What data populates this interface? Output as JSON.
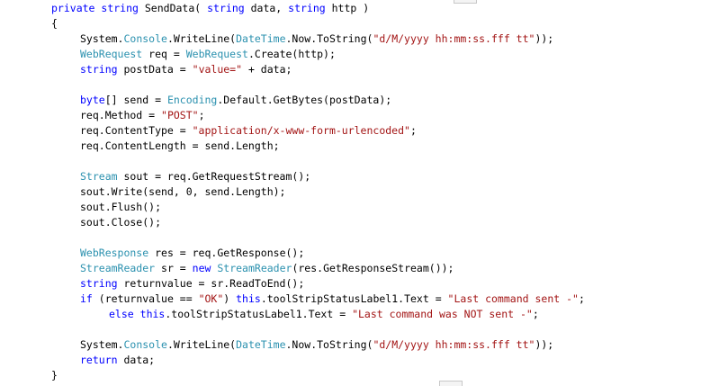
{
  "editor": {
    "colors": {
      "keyword": "#0000ff",
      "type": "#2b91af",
      "string": "#a31515",
      "plain": "#000000",
      "background": "#ffffff"
    },
    "lines": [
      {
        "tokens": [
          [
            "kw",
            "private"
          ],
          [
            "pl",
            " "
          ],
          [
            "kw",
            "string"
          ],
          [
            "pl",
            " SendData( "
          ],
          [
            "kw",
            "string"
          ],
          [
            "pl",
            " data, "
          ],
          [
            "kw",
            "string"
          ],
          [
            "pl",
            " http )"
          ]
        ]
      },
      {
        "tokens": [
          [
            "pl",
            "{"
          ]
        ]
      },
      {
        "tokens": [
          [
            "pl",
            "System."
          ],
          [
            "ty",
            "Console"
          ],
          [
            "pl",
            ".WriteLine("
          ],
          [
            "ty",
            "DateTime"
          ],
          [
            "pl",
            ".Now.ToString("
          ],
          [
            "st",
            "\"d/M/yyyy hh:mm:ss.fff tt\""
          ],
          [
            "pl",
            "));"
          ]
        ]
      },
      {
        "tokens": [
          [
            "ty",
            "WebRequest"
          ],
          [
            "pl",
            " req = "
          ],
          [
            "ty",
            "WebRequest"
          ],
          [
            "pl",
            ".Create(http);"
          ]
        ]
      },
      {
        "tokens": [
          [
            "kw",
            "string"
          ],
          [
            "pl",
            " postData = "
          ],
          [
            "st",
            "\"value=\""
          ],
          [
            "pl",
            " + data;"
          ]
        ]
      },
      {
        "tokens": []
      },
      {
        "tokens": [
          [
            "kw",
            "byte"
          ],
          [
            "pl",
            "[] send = "
          ],
          [
            "ty",
            "Encoding"
          ],
          [
            "pl",
            ".Default.GetBytes(postData);"
          ]
        ]
      },
      {
        "tokens": [
          [
            "pl",
            "req.Method = "
          ],
          [
            "st",
            "\"POST\""
          ],
          [
            "pl",
            ";"
          ]
        ]
      },
      {
        "tokens": [
          [
            "pl",
            "req.ContentType = "
          ],
          [
            "st",
            "\"application/x-www-form-urlencoded\""
          ],
          [
            "pl",
            ";"
          ]
        ]
      },
      {
        "tokens": [
          [
            "pl",
            "req.ContentLength = send.Length;"
          ]
        ]
      },
      {
        "tokens": []
      },
      {
        "tokens": [
          [
            "ty",
            "Stream"
          ],
          [
            "pl",
            " sout = req.GetRequestStream();"
          ]
        ]
      },
      {
        "tokens": [
          [
            "pl",
            "sout.Write(send, 0, send.Length);"
          ]
        ]
      },
      {
        "tokens": [
          [
            "pl",
            "sout.Flush();"
          ]
        ]
      },
      {
        "tokens": [
          [
            "pl",
            "sout.Close();"
          ]
        ]
      },
      {
        "tokens": []
      },
      {
        "tokens": [
          [
            "ty",
            "WebResponse"
          ],
          [
            "pl",
            " res = req.GetResponse();"
          ]
        ]
      },
      {
        "tokens": [
          [
            "ty",
            "StreamReader"
          ],
          [
            "pl",
            " sr = "
          ],
          [
            "kw",
            "new"
          ],
          [
            "pl",
            " "
          ],
          [
            "ty",
            "StreamReader"
          ],
          [
            "pl",
            "(res.GetResponseStream());"
          ]
        ]
      },
      {
        "tokens": [
          [
            "kw",
            "string"
          ],
          [
            "pl",
            " returnvalue = sr.ReadToEnd();"
          ]
        ]
      },
      {
        "tokens": [
          [
            "kw",
            "if"
          ],
          [
            "pl",
            " (returnvalue == "
          ],
          [
            "st",
            "\"OK\""
          ],
          [
            "pl",
            ") "
          ],
          [
            "kw",
            "this"
          ],
          [
            "pl",
            ".toolStripStatusLabel1.Text = "
          ],
          [
            "st",
            "\"Last command sent -\""
          ],
          [
            "pl",
            ";"
          ]
        ]
      },
      {
        "tokens": [
          [
            "kw",
            "else"
          ],
          [
            "pl",
            " "
          ],
          [
            "kw",
            "this"
          ],
          [
            "pl",
            ".toolStripStatusLabel1.Text = "
          ],
          [
            "st",
            "\"Last command was NOT sent -\""
          ],
          [
            "pl",
            ";"
          ]
        ]
      },
      {
        "tokens": []
      },
      {
        "tokens": [
          [
            "pl",
            "System."
          ],
          [
            "ty",
            "Console"
          ],
          [
            "pl",
            ".WriteLine("
          ],
          [
            "ty",
            "DateTime"
          ],
          [
            "pl",
            ".Now.ToString("
          ],
          [
            "st",
            "\"d/M/yyyy hh:mm:ss.fff tt\""
          ],
          [
            "pl",
            "));"
          ]
        ]
      },
      {
        "tokens": [
          [
            "kw",
            "return"
          ],
          [
            "pl",
            " data;"
          ]
        ]
      },
      {
        "tokens": [
          [
            "pl",
            "}"
          ]
        ]
      }
    ]
  }
}
